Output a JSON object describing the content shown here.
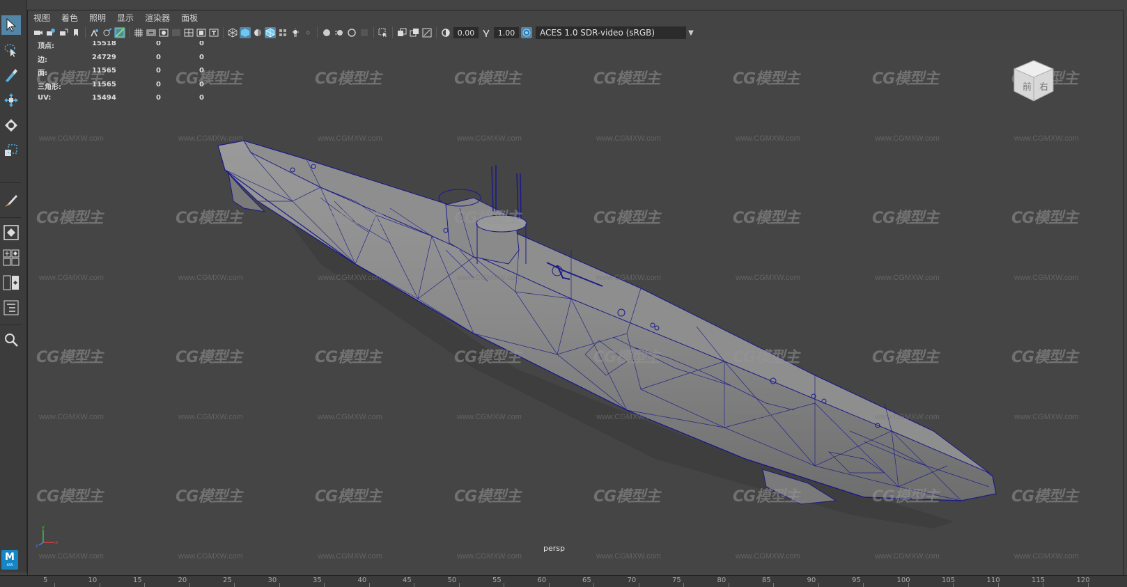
{
  "menu": [
    "视图",
    "着色",
    "照明",
    "显示",
    "渲染器",
    "面板"
  ],
  "toolbar": {
    "exposure": "0.00",
    "gamma": "1.00",
    "color_view": "ACES 1.0 SDR-video (sRGB)"
  },
  "hud": {
    "rows": [
      {
        "label": "顶点:",
        "v1": "15518",
        "v2": "0",
        "v3": "0"
      },
      {
        "label": "边:",
        "v1": "24729",
        "v2": "0",
        "v3": "0"
      },
      {
        "label": "面:",
        "v1": "11565",
        "v2": "0",
        "v3": "0"
      },
      {
        "label": "三角形:",
        "v1": "11565",
        "v2": "0",
        "v3": "0"
      },
      {
        "label": "UV:",
        "v1": "15494",
        "v2": "0",
        "v3": "0"
      }
    ]
  },
  "viewport": {
    "camera": "persp",
    "viewcube_faces": [
      "前",
      "右"
    ]
  },
  "watermark": {
    "logo": "CG模型主",
    "url": "www.CGMXW.com"
  },
  "app_logo": {
    "letter": "M",
    "sub": "AYA"
  },
  "timeline": {
    "ticks": [
      "5",
      "10",
      "15",
      "20",
      "25",
      "30",
      "35",
      "40",
      "45",
      "50",
      "55",
      "60",
      "65",
      "70",
      "75",
      "80",
      "85",
      "90",
      "95",
      "100",
      "105",
      "110",
      "115",
      "120"
    ]
  },
  "colors": {
    "viewport_bg": "#454545",
    "wireframe": "#1a1a8a",
    "accent": "#5285a6"
  }
}
